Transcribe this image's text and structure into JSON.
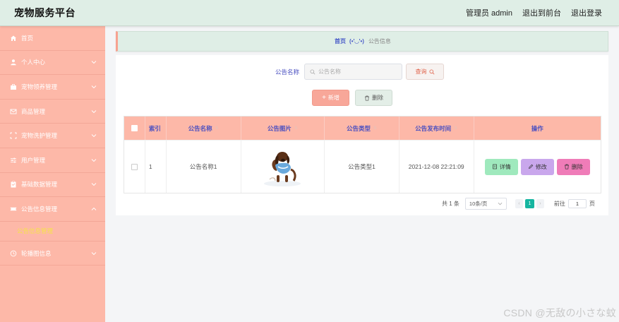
{
  "app": {
    "title": "宠物服务平台"
  },
  "topnav": {
    "user": "管理员 admin",
    "frontend": "退出到前台",
    "logout": "退出登录"
  },
  "sidebar": {
    "items": [
      {
        "label": "首页",
        "icon": "home-icon",
        "has_chevron": false
      },
      {
        "label": "个人中心",
        "icon": "user-icon",
        "has_chevron": true
      },
      {
        "label": "宠物领养管理",
        "icon": "briefcase-icon",
        "has_chevron": true
      },
      {
        "label": "商品管理",
        "icon": "mail-icon",
        "has_chevron": true
      },
      {
        "label": "宠物洗护管理",
        "icon": "scan-icon",
        "has_chevron": true
      },
      {
        "label": "用户管理",
        "icon": "sliders-icon",
        "has_chevron": true
      },
      {
        "label": "基础数据管理",
        "icon": "clipboard-icon",
        "has_chevron": true
      },
      {
        "label": "公告信息管理",
        "icon": "ticket-icon",
        "has_chevron": true,
        "expanded": true
      },
      {
        "label": "轮播图信息",
        "icon": "clock-icon",
        "has_chevron": true
      }
    ],
    "submenu": {
      "label": "公告信息管理"
    }
  },
  "breadcrumb": {
    "home": "首页",
    "emoji": "(•'◡'•)",
    "current": "公告信息"
  },
  "search": {
    "label": "公告名称",
    "placeholder": "公告名称",
    "button": "查询"
  },
  "actions": {
    "add": "新增",
    "delete": "删除"
  },
  "table": {
    "headers": {
      "index": "索引",
      "name": "公告名称",
      "image": "公告图片",
      "type": "公告类型",
      "time": "公告发布时间",
      "ops": "操作"
    },
    "rows": [
      {
        "index": "1",
        "name": "公告名称1",
        "type": "公告类型1",
        "time": "2021-12-08 22:21:09"
      }
    ],
    "ops": {
      "detail": "详情",
      "edit": "修改",
      "delete": "删除"
    }
  },
  "pagination": {
    "total": "共 1 条",
    "page_size": "10条/页",
    "current": "1",
    "goto_label": "前往",
    "goto_value": "1",
    "goto_suffix": "页"
  },
  "watermark": "CSDN @无敌の小さな蚊",
  "colors": {
    "sidebar": "#fdb8a8",
    "header": "#dfeee6",
    "accent": "#4a4fc0",
    "pager_active": "#16b5a0"
  }
}
